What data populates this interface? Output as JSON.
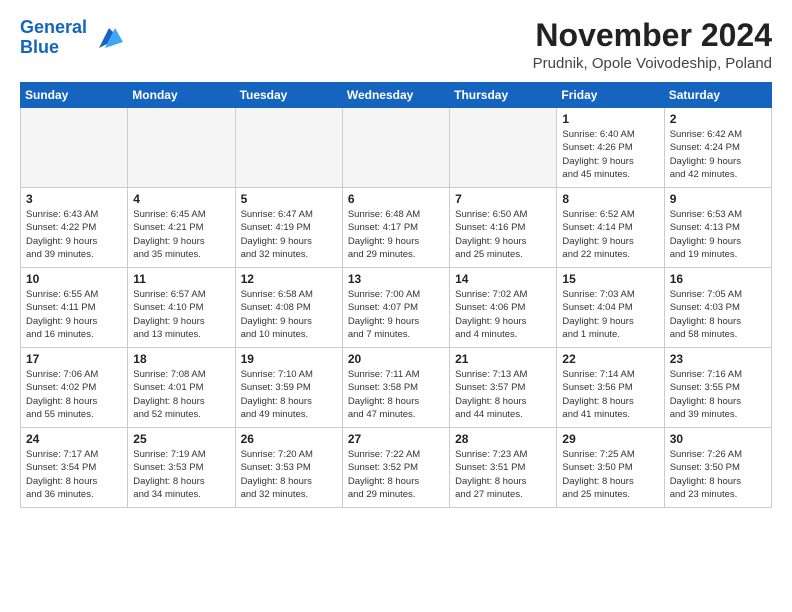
{
  "header": {
    "logo_line1": "General",
    "logo_line2": "Blue",
    "month": "November 2024",
    "location": "Prudnik, Opole Voivodeship, Poland"
  },
  "weekdays": [
    "Sunday",
    "Monday",
    "Tuesday",
    "Wednesday",
    "Thursday",
    "Friday",
    "Saturday"
  ],
  "weeks": [
    [
      {
        "day": "",
        "info": "",
        "empty": true
      },
      {
        "day": "",
        "info": "",
        "empty": true
      },
      {
        "day": "",
        "info": "",
        "empty": true
      },
      {
        "day": "",
        "info": "",
        "empty": true
      },
      {
        "day": "",
        "info": "",
        "empty": true
      },
      {
        "day": "1",
        "info": "Sunrise: 6:40 AM\nSunset: 4:26 PM\nDaylight: 9 hours\nand 45 minutes.",
        "empty": false
      },
      {
        "day": "2",
        "info": "Sunrise: 6:42 AM\nSunset: 4:24 PM\nDaylight: 9 hours\nand 42 minutes.",
        "empty": false
      }
    ],
    [
      {
        "day": "3",
        "info": "Sunrise: 6:43 AM\nSunset: 4:22 PM\nDaylight: 9 hours\nand 39 minutes.",
        "empty": false
      },
      {
        "day": "4",
        "info": "Sunrise: 6:45 AM\nSunset: 4:21 PM\nDaylight: 9 hours\nand 35 minutes.",
        "empty": false
      },
      {
        "day": "5",
        "info": "Sunrise: 6:47 AM\nSunset: 4:19 PM\nDaylight: 9 hours\nand 32 minutes.",
        "empty": false
      },
      {
        "day": "6",
        "info": "Sunrise: 6:48 AM\nSunset: 4:17 PM\nDaylight: 9 hours\nand 29 minutes.",
        "empty": false
      },
      {
        "day": "7",
        "info": "Sunrise: 6:50 AM\nSunset: 4:16 PM\nDaylight: 9 hours\nand 25 minutes.",
        "empty": false
      },
      {
        "day": "8",
        "info": "Sunrise: 6:52 AM\nSunset: 4:14 PM\nDaylight: 9 hours\nand 22 minutes.",
        "empty": false
      },
      {
        "day": "9",
        "info": "Sunrise: 6:53 AM\nSunset: 4:13 PM\nDaylight: 9 hours\nand 19 minutes.",
        "empty": false
      }
    ],
    [
      {
        "day": "10",
        "info": "Sunrise: 6:55 AM\nSunset: 4:11 PM\nDaylight: 9 hours\nand 16 minutes.",
        "empty": false
      },
      {
        "day": "11",
        "info": "Sunrise: 6:57 AM\nSunset: 4:10 PM\nDaylight: 9 hours\nand 13 minutes.",
        "empty": false
      },
      {
        "day": "12",
        "info": "Sunrise: 6:58 AM\nSunset: 4:08 PM\nDaylight: 9 hours\nand 10 minutes.",
        "empty": false
      },
      {
        "day": "13",
        "info": "Sunrise: 7:00 AM\nSunset: 4:07 PM\nDaylight: 9 hours\nand 7 minutes.",
        "empty": false
      },
      {
        "day": "14",
        "info": "Sunrise: 7:02 AM\nSunset: 4:06 PM\nDaylight: 9 hours\nand 4 minutes.",
        "empty": false
      },
      {
        "day": "15",
        "info": "Sunrise: 7:03 AM\nSunset: 4:04 PM\nDaylight: 9 hours\nand 1 minute.",
        "empty": false
      },
      {
        "day": "16",
        "info": "Sunrise: 7:05 AM\nSunset: 4:03 PM\nDaylight: 8 hours\nand 58 minutes.",
        "empty": false
      }
    ],
    [
      {
        "day": "17",
        "info": "Sunrise: 7:06 AM\nSunset: 4:02 PM\nDaylight: 8 hours\nand 55 minutes.",
        "empty": false
      },
      {
        "day": "18",
        "info": "Sunrise: 7:08 AM\nSunset: 4:01 PM\nDaylight: 8 hours\nand 52 minutes.",
        "empty": false
      },
      {
        "day": "19",
        "info": "Sunrise: 7:10 AM\nSunset: 3:59 PM\nDaylight: 8 hours\nand 49 minutes.",
        "empty": false
      },
      {
        "day": "20",
        "info": "Sunrise: 7:11 AM\nSunset: 3:58 PM\nDaylight: 8 hours\nand 47 minutes.",
        "empty": false
      },
      {
        "day": "21",
        "info": "Sunrise: 7:13 AM\nSunset: 3:57 PM\nDaylight: 8 hours\nand 44 minutes.",
        "empty": false
      },
      {
        "day": "22",
        "info": "Sunrise: 7:14 AM\nSunset: 3:56 PM\nDaylight: 8 hours\nand 41 minutes.",
        "empty": false
      },
      {
        "day": "23",
        "info": "Sunrise: 7:16 AM\nSunset: 3:55 PM\nDaylight: 8 hours\nand 39 minutes.",
        "empty": false
      }
    ],
    [
      {
        "day": "24",
        "info": "Sunrise: 7:17 AM\nSunset: 3:54 PM\nDaylight: 8 hours\nand 36 minutes.",
        "empty": false
      },
      {
        "day": "25",
        "info": "Sunrise: 7:19 AM\nSunset: 3:53 PM\nDaylight: 8 hours\nand 34 minutes.",
        "empty": false
      },
      {
        "day": "26",
        "info": "Sunrise: 7:20 AM\nSunset: 3:53 PM\nDaylight: 8 hours\nand 32 minutes.",
        "empty": false
      },
      {
        "day": "27",
        "info": "Sunrise: 7:22 AM\nSunset: 3:52 PM\nDaylight: 8 hours\nand 29 minutes.",
        "empty": false
      },
      {
        "day": "28",
        "info": "Sunrise: 7:23 AM\nSunset: 3:51 PM\nDaylight: 8 hours\nand 27 minutes.",
        "empty": false
      },
      {
        "day": "29",
        "info": "Sunrise: 7:25 AM\nSunset: 3:50 PM\nDaylight: 8 hours\nand 25 minutes.",
        "empty": false
      },
      {
        "day": "30",
        "info": "Sunrise: 7:26 AM\nSunset: 3:50 PM\nDaylight: 8 hours\nand 23 minutes.",
        "empty": false
      }
    ]
  ]
}
